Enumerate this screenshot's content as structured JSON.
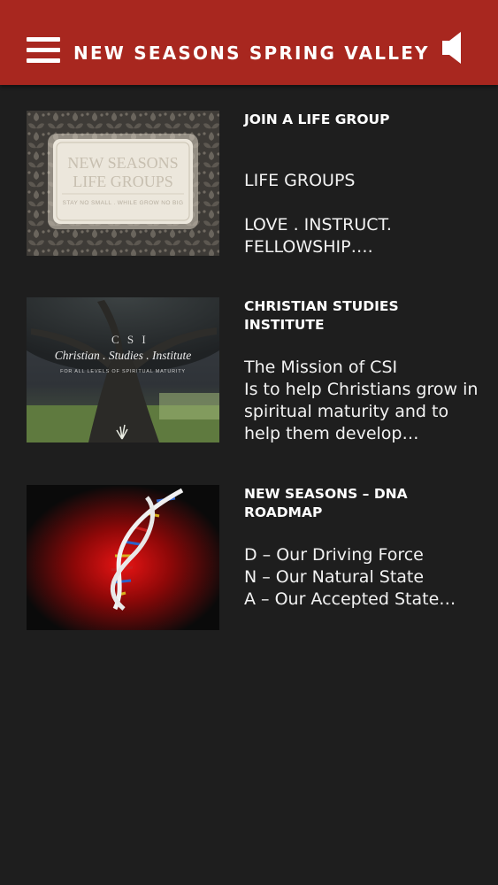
{
  "header": {
    "title": "NEW SEASONS SPRING VALLEY",
    "menu_icon": "hamburger-menu-icon",
    "sound_icon": "speaker-icon",
    "background_color": "#a8271f"
  },
  "items": [
    {
      "title": "JOIN A LIFE GROUP",
      "excerpt": "LIFE GROUPS\n\nLOVE . INSTRUCT. FELLOWSHIP….",
      "thumbnail": {
        "line1": "NEW SEASONS",
        "line2": "LIFE GROUPS",
        "tagline": "STAY NO SMALL . WHILE GROW NO BIG",
        "colors": {
          "pattern": "#4b4742",
          "plaque": "#e6e0d4",
          "text": "#cfc8bb"
        }
      }
    },
    {
      "title": "CHRISTIAN STUDIES INSTITUTE",
      "excerpt": "The Mission of CSI\nIs to help Christians grow in spiritual maturity and to help them develop…",
      "thumbnail": {
        "abbrev": "C S I",
        "caption": "Christian . Studies . Institute",
        "subcaption": "FOR ALL LEVELS OF SPIRITUAL MATURITY"
      }
    },
    {
      "title": "NEW SEASONS – DNA ROADMAP",
      "excerpt": "D – Our Driving Force\nN – Our Natural State\nA – Our Accepted State…",
      "thumbnail": {
        "image": "dna-helix",
        "colors": {
          "glow": "#d10f0f",
          "background": "#0a0a0a"
        }
      }
    }
  ]
}
